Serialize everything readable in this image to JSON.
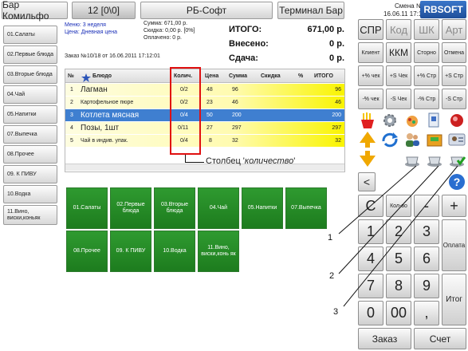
{
  "header": {
    "bar_label": "Бар Комильфо",
    "counter_label": "12 [0\\0]",
    "company_label": "РБ-Софт",
    "terminal_label": "Терминал Бар",
    "shift_label": "Смена №10",
    "datetime_label": "16.06.11 17:14",
    "logo_text": "RBSOFT"
  },
  "sidebar": {
    "items": [
      {
        "label": "01.Салаты"
      },
      {
        "label": "02.Первые блюда"
      },
      {
        "label": "03.Вторые блюда"
      },
      {
        "label": "04.Чай"
      },
      {
        "label": "05.Напитки"
      },
      {
        "label": "07.Выпечка"
      },
      {
        "label": "08.Прочее"
      },
      {
        "label": "09. К ПИВУ"
      },
      {
        "label": "10.Водка"
      },
      {
        "label": "11.Вино, виски,коньяк"
      }
    ]
  },
  "info": {
    "menu_line": "Меню: 3 неделя",
    "price_line": "Цена: Дневная цена",
    "sum_line": "Сумма: 671,00 р.",
    "discount_line": "Скидка: 0,00 р. [0%]",
    "paid_line": "Оплачено: 0 р.",
    "order_line": "Заказ №10/18 от 16.06.2011 17:12:01"
  },
  "totals": {
    "total_label": "ИТОГО:",
    "total_value": "671,00 р.",
    "deposited_label": "Внесено:",
    "deposited_value": "0 р.",
    "change_label": "Сдача:",
    "change_value": "0 р."
  },
  "table": {
    "headers": [
      "№",
      "Блюдо",
      "Колич.",
      "Цена",
      "Сумма",
      "Скидка",
      "%",
      "ИТОГО"
    ],
    "rows": [
      {
        "n": "1",
        "dish": "Лагман",
        "qty": "0/2",
        "price": "48",
        "sum": "96",
        "discount": "",
        "pct": "",
        "total": "96"
      },
      {
        "n": "2",
        "dish": "Картофельное пюре",
        "qty": "0/2",
        "price": "23",
        "sum": "46",
        "discount": "",
        "pct": "",
        "total": "46"
      },
      {
        "n": "3",
        "dish": "Котлета мясная",
        "qty": "0/4",
        "price": "50",
        "sum": "200",
        "discount": "",
        "pct": "",
        "total": "200"
      },
      {
        "n": "4",
        "dish": "Позы, 1шт",
        "qty": "0/11",
        "price": "27",
        "sum": "297",
        "discount": "",
        "pct": "",
        "total": "297"
      },
      {
        "n": "5",
        "dish": "Чай в индив. упак.",
        "qty": "0/4",
        "price": "8",
        "sum": "32",
        "discount": "",
        "pct": "",
        "total": "32"
      }
    ]
  },
  "annotation": {
    "column_note_prefix": "Столбец '",
    "column_note_word": "количество",
    "column_note_suffix": "'",
    "callout_1": "1",
    "callout_2": "2",
    "callout_3": "3"
  },
  "categories": [
    {
      "label": "01.Салаты"
    },
    {
      "label": "02.Первые блюда"
    },
    {
      "label": "03.Вторые блюда"
    },
    {
      "label": "04.Чай"
    },
    {
      "label": "05.Напитки"
    },
    {
      "label": "07.Выпечка"
    },
    {
      "label": "08.Прочее"
    },
    {
      "label": "09. К ПИВУ"
    },
    {
      "label": "10.Водка"
    },
    {
      "label": "11.Вино, виски,конь як"
    }
  ],
  "right_panel": {
    "row1": [
      "СПР",
      "Код",
      "ШК",
      "Арт"
    ],
    "row2": [
      "Клиент",
      "ККМ",
      "Сторно",
      "Отмена"
    ],
    "row3": [
      "+% чек",
      "+S Чек",
      "+% Стр",
      "+S Стр"
    ],
    "row4": [
      "-% чек",
      "-S Чек",
      "-% Стр",
      "-S Стр"
    ],
    "back_label": "<",
    "clear_label": "С",
    "qty_label": "Кол-во",
    "minus_label": "-",
    "plus_label": "+",
    "pay_label": "Оплата",
    "total_btn_label": "Итог",
    "digits": [
      "1",
      "2",
      "3",
      "4",
      "5",
      "6",
      "7",
      "8",
      "9",
      "0",
      "00",
      ","
    ],
    "order_label": "Заказ",
    "bill_label": "Счет"
  }
}
